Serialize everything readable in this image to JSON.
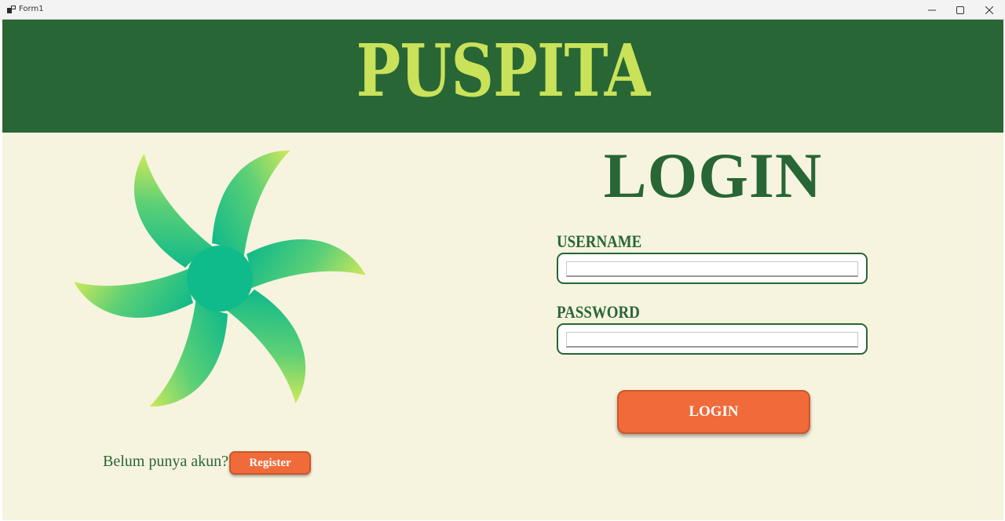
{
  "window": {
    "title": "Form1",
    "controls": {
      "minimize": "minimize",
      "maximize": "maximize",
      "close": "close"
    }
  },
  "header": {
    "brand": "PUSPITA",
    "background_color": "#286635",
    "brand_color": "#c9e25a"
  },
  "login": {
    "title": "LOGIN",
    "username_label": "USERNAME",
    "username_value": "",
    "password_label": "PASSWORD",
    "password_value": "",
    "button_label": "LOGIN"
  },
  "register": {
    "prompt": "Belum punya akun?",
    "button_label": "Register"
  },
  "colors": {
    "background": "#f6f4de",
    "accent_green": "#286635",
    "button_orange": "#f06a3a"
  },
  "icons": {
    "logo": "green-flower-swirl-logo",
    "app": "form-app-icon"
  }
}
